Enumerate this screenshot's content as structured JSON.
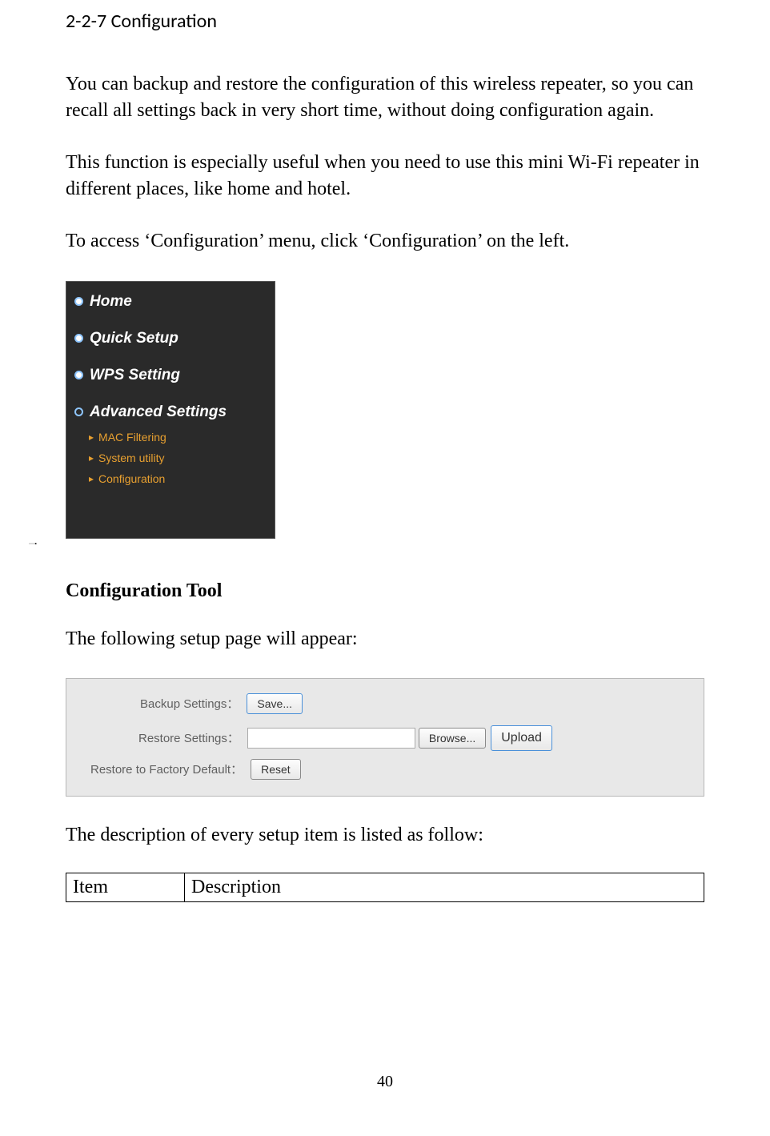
{
  "section_title": "2-2-7 Configuration",
  "paragraphs": {
    "p1": "You can backup and restore the configuration of this wireless repeater, so you can recall all settings back in very short time, without doing configuration again.",
    "p2": "This function is especially useful when you need to use this mini Wi-Fi repeater in different places, like home and hotel.",
    "p3": "To access ‘Configuration’ menu, click ‘Configuration’ on the left."
  },
  "sidebar": {
    "items": [
      {
        "label": "Home"
      },
      {
        "label": "Quick Setup"
      },
      {
        "label": "WPS Setting"
      },
      {
        "label": "Advanced Settings"
      }
    ],
    "sub_items": [
      {
        "label": "MAC Filtering"
      },
      {
        "label": "System utility"
      },
      {
        "label": "Configuration"
      }
    ]
  },
  "config_heading": "Configuration Tool",
  "config_intro": "The following setup page will appear:",
  "config_tool": {
    "backup_label": "Backup Settings：",
    "save_button": "Save...",
    "restore_label": "Restore Settings：",
    "restore_input": "",
    "browse_button": "Browse...",
    "upload_button": "Upload",
    "factory_label": "Restore to Factory Default：",
    "reset_button": "Reset"
  },
  "post_config_text": "The description of every setup item is listed as follow:",
  "table": {
    "head_item": "Item",
    "head_desc": "Description"
  },
  "page_number": "40"
}
